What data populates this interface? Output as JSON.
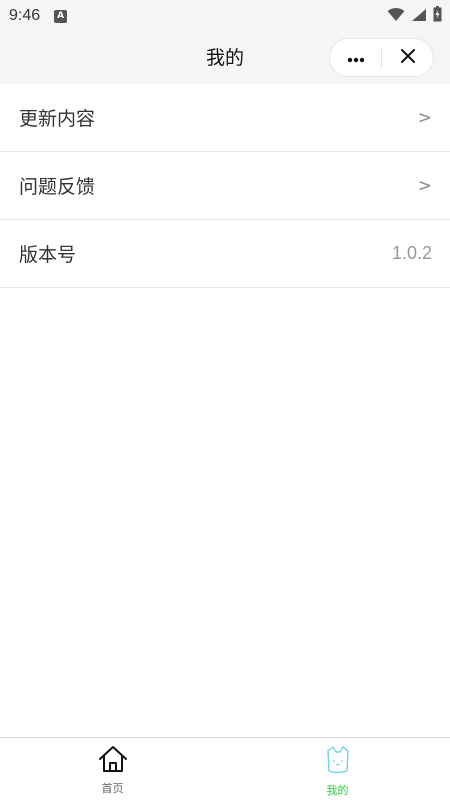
{
  "status_bar": {
    "time": "9:46",
    "notification_icon": "a-notification-icon",
    "icons": [
      "wifi-icon",
      "signal-icon",
      "battery-icon"
    ]
  },
  "nav": {
    "title": "我的",
    "more_icon": "more-dots-icon",
    "close_icon": "close-icon"
  },
  "menu": {
    "items": [
      {
        "label": "更新内容",
        "indicator": ">"
      },
      {
        "label": "问题反馈",
        "indicator": ">"
      },
      {
        "label": "版本号",
        "value": "1.0.2"
      }
    ]
  },
  "tabbar": {
    "tabs": [
      {
        "label": "首页",
        "icon": "home-icon",
        "active": false,
        "color": "#666666"
      },
      {
        "label": "我的",
        "icon": "cat-face-icon",
        "active": true,
        "color": "#2ecc40"
      }
    ]
  },
  "colors": {
    "background": "#f5f5f5",
    "active_tab": "#2ecc40",
    "cat_icon": "#6fd4e8"
  }
}
